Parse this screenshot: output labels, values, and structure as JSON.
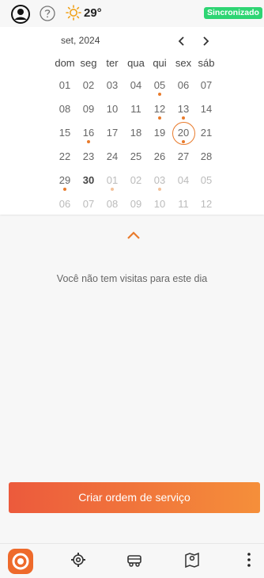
{
  "status": {
    "temperature": "29°",
    "sync_label": "Sincronizado",
    "sync_color": "#2ed573",
    "icons": {
      "avatar": "user-circle-icon",
      "help": "help-circle-icon",
      "weather": "sun-icon"
    }
  },
  "calendar": {
    "month_label": "set, 2024",
    "prev_icon": "chevron-left-icon",
    "next_icon": "chevron-right-icon",
    "weekdays": [
      "dom",
      "seg",
      "ter",
      "qua",
      "qui",
      "sex",
      "sáb"
    ],
    "weeks": [
      [
        {
          "d": "01"
        },
        {
          "d": "02"
        },
        {
          "d": "03"
        },
        {
          "d": "04"
        },
        {
          "d": "05",
          "dot": true
        },
        {
          "d": "06"
        },
        {
          "d": "07"
        }
      ],
      [
        {
          "d": "08"
        },
        {
          "d": "09"
        },
        {
          "d": "10"
        },
        {
          "d": "11"
        },
        {
          "d": "12",
          "dot": true
        },
        {
          "d": "13",
          "dot": true
        },
        {
          "d": "14"
        }
      ],
      [
        {
          "d": "15"
        },
        {
          "d": "16",
          "dot": true
        },
        {
          "d": "17"
        },
        {
          "d": "18"
        },
        {
          "d": "19"
        },
        {
          "d": "20",
          "dot": true,
          "selected": true
        },
        {
          "d": "21"
        }
      ],
      [
        {
          "d": "22"
        },
        {
          "d": "23"
        },
        {
          "d": "24"
        },
        {
          "d": "25"
        },
        {
          "d": "26"
        },
        {
          "d": "27"
        },
        {
          "d": "28"
        }
      ],
      [
        {
          "d": "29",
          "dot": true
        },
        {
          "d": "30",
          "bold": true
        },
        {
          "d": "01",
          "other": true,
          "dot": true
        },
        {
          "d": "02",
          "other": true
        },
        {
          "d": "03",
          "other": true,
          "dot": true
        },
        {
          "d": "04",
          "other": true
        },
        {
          "d": "05",
          "other": true
        }
      ],
      [
        {
          "d": "06",
          "other": true
        },
        {
          "d": "07",
          "other": true
        },
        {
          "d": "08",
          "other": true
        },
        {
          "d": "09",
          "other": true
        },
        {
          "d": "10",
          "other": true
        },
        {
          "d": "11",
          "other": true
        },
        {
          "d": "12",
          "other": true
        }
      ]
    ],
    "collapse_icon": "chevron-up-icon",
    "accent": "#e97b2c"
  },
  "main": {
    "empty_message": "Você não tem visitas para este dia",
    "cta_label": "Criar ordem de serviço"
  },
  "bottom_nav": {
    "items": [
      "logo-icon",
      "settings-tools-icon",
      "vehicle-icon",
      "map-pin-icon",
      "more-vertical-icon"
    ]
  }
}
